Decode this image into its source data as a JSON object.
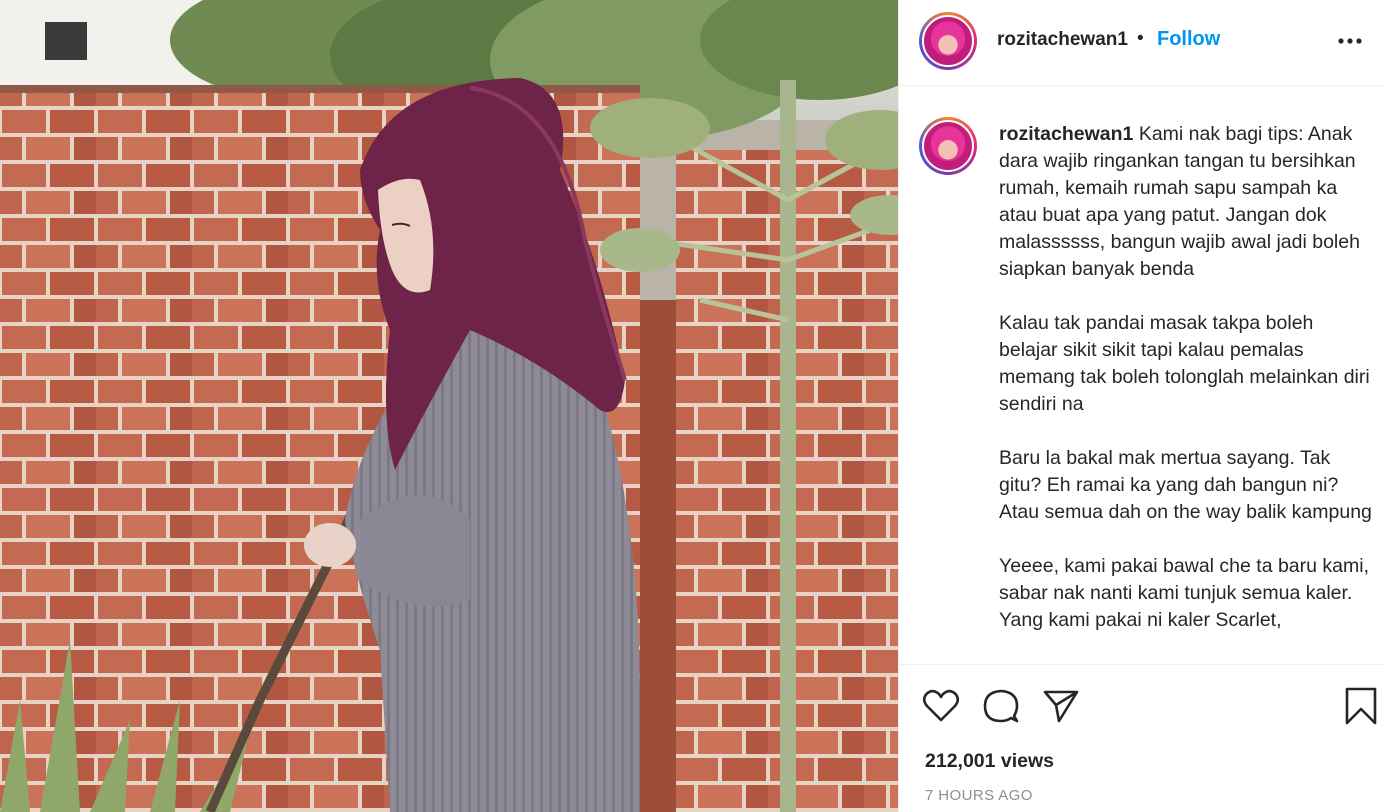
{
  "post": {
    "username": "rozitachewan1",
    "follow_label": "Follow",
    "separator": "•",
    "caption": {
      "username": "rozitachewan1",
      "paragraphs": [
        "Kami nak bagi tips: Anak dara wajib ringankan tangan tu bersihkan rumah, kemaih rumah sapu sampah ka atau buat apa yang patut. Jangan dok malassssss, bangun wajib awal jadi boleh siapkan banyak benda",
        "Kalau tak pandai masak takpa boleh belajar sikit sikit tapi kalau pemalas memang tak boleh tolonglah melainkan diri sendiri na",
        "Baru la bakal mak mertua sayang. Tak gitu? Eh ramai ka yang dah bangun ni? Atau semua dah on the way balik kampung",
        "Yeeee, kami pakai bawal che ta baru kami, sabar nak nanti kami tunjuk semua kaler. Yang kami pakai ni kaler Scarlet,"
      ]
    },
    "views": "212,001 views",
    "timestamp": "7 HOURS AGO"
  },
  "icons": {
    "more": "more-options-icon",
    "like": "heart-icon",
    "comment": "comment-icon",
    "share": "share-icon",
    "save": "bookmark-icon"
  },
  "colors": {
    "follow": "#0095f6",
    "text": "#262626",
    "muted": "#8e8e8e",
    "hijab": "#6e2449",
    "robe": "#8d8a95",
    "brick": "#b86048"
  }
}
